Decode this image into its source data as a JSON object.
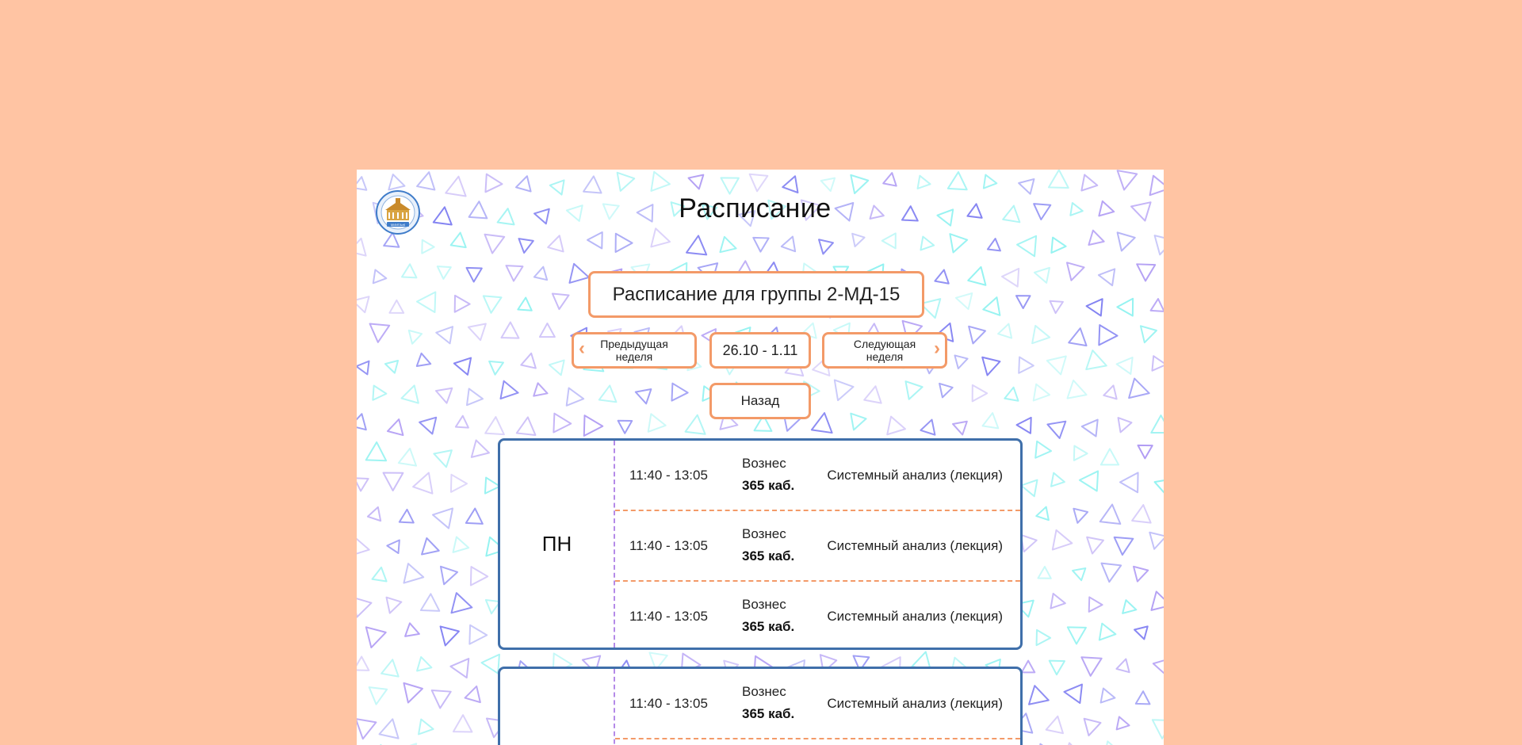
{
  "page": {
    "title": "Расписание",
    "logo_text": "МИИГАиК"
  },
  "group": {
    "label": "Расписание для группы 2-МД-15"
  },
  "nav": {
    "prev_line1": "Предыдущая",
    "prev_line2": "неделя",
    "week_range": "26.10 - 1.11",
    "next_line1": "Следующая",
    "next_line2": "неделя",
    "back": "Назад",
    "prev_icon": "chevron-left-icon",
    "next_icon": "chevron-right-icon"
  },
  "days": [
    {
      "label": "ПН",
      "lessons": [
        {
          "time": "11:40 - 13:05",
          "teacher": "Вознес",
          "room": "365 каб.",
          "subject": "Системный анализ (лекция)"
        },
        {
          "time": "11:40 - 13:05",
          "teacher": "Вознес",
          "room": "365 каб.",
          "subject": "Системный анализ (лекция)"
        },
        {
          "time": "11:40 - 13:05",
          "teacher": "Вознес",
          "room": "365 каб.",
          "subject": "Системный анализ (лекция)"
        }
      ]
    },
    {
      "label": "",
      "lessons": [
        {
          "time": "11:40 - 13:05",
          "teacher": "Вознес",
          "room": "365 каб.",
          "subject": "Системный анализ (лекция)"
        }
      ]
    }
  ],
  "colors": {
    "background": "#ffc4a3",
    "accent_orange": "#f39a68",
    "card_border": "#3f6faa",
    "divider_violet": "#b48ae8"
  }
}
